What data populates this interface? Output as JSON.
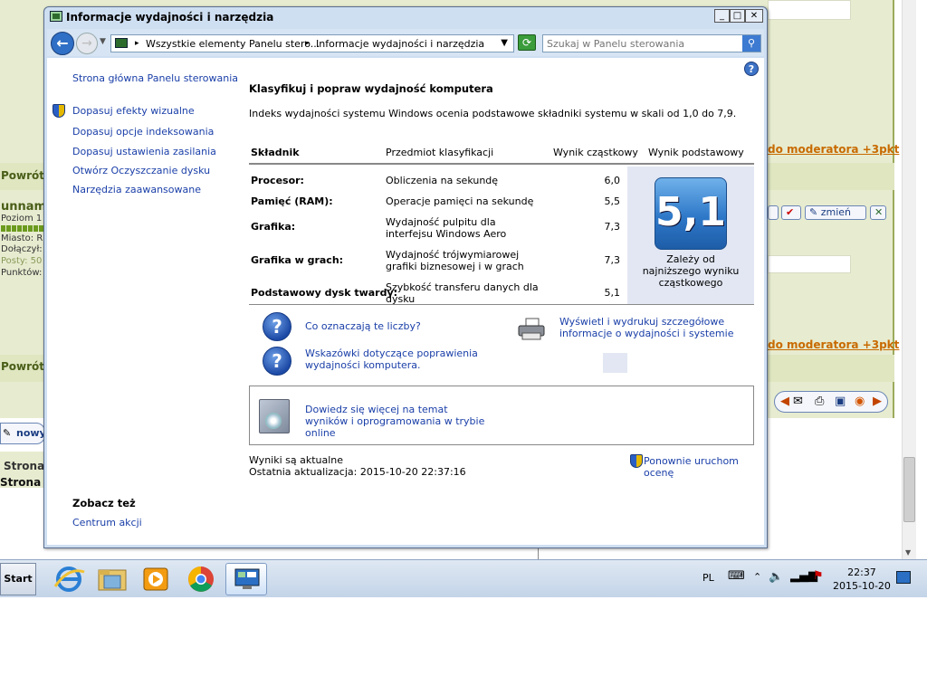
{
  "background_page": {
    "left_labels": [
      "Powrót",
      "unnam",
      "Poziom 1",
      "Miasto: R",
      "Dołączył:",
      "Posty: 50",
      "Punktów:",
      "Powrót",
      "nowy",
      "Strona",
      "Strona 1"
    ],
    "right_links": [
      "do moderatora +3pkt",
      "do moderatora +3pkt"
    ],
    "edit_button": "zmień"
  },
  "window": {
    "title": "Informacje wydajności i narzędzia",
    "controls": {
      "minimize": "_",
      "maximize": "□",
      "close": "✕"
    },
    "address": {
      "segment1": "Wszystkie elementy Panelu stero...",
      "segment2": "Informacje wydajności i narzędzia"
    },
    "search": {
      "placeholder": "Szukaj w Panelu sterowania"
    }
  },
  "sidebar": {
    "home": "Strona główna Panelu sterowania",
    "links": [
      "Dopasuj efekty wizualne",
      "Dopasuj opcje indeksowania",
      "Dopasuj ustawienia zasilania",
      "Otwórz Oczyszczanie dysku",
      "Narzędzia zaawansowane"
    ],
    "see_also_title": "Zobacz też",
    "see_also_link": "Centrum akcji"
  },
  "main": {
    "heading": "Klasyfikuj i popraw wydajność komputera",
    "description": "Indeks wydajności systemu Windows ocenia podstawowe składniki systemu w skali od 1,0 do 7,9.",
    "table": {
      "headers": [
        "Składnik",
        "Przedmiot klasyfikacji",
        "Wynik cząstkowy",
        "Wynik podstawowy"
      ],
      "rows": [
        {
          "component": "Procesor:",
          "subject": "Obliczenia na sekundę",
          "score": "6,0"
        },
        {
          "component": "Pamięć (RAM):",
          "subject": "Operacje pamięci na sekundę",
          "score": "5,5"
        },
        {
          "component": "Grafika:",
          "subject": "Wydajność pulpitu dla interfejsu Windows Aero",
          "score": "7,3"
        },
        {
          "component": "Grafika w grach:",
          "subject": "Wydajność trójwymiarowej grafiki biznesowej i w grach",
          "score": "7,3"
        },
        {
          "component": "Podstawowy dysk twardy:",
          "subject": "Szybkość transferu danych dla dysku",
          "score": "5,1"
        }
      ],
      "base_score": "5,1",
      "base_caption": "Zależy od najniższego wyniku cząstkowego"
    },
    "help_links": [
      "Co oznaczają te liczby?",
      "Wskazówki dotyczące poprawienia wydajności komputera."
    ],
    "print_link": "Wyświetl i wydrukuj szczegółowe informacje o wydajności i systemie",
    "online_link": "Dowiedz się więcej na temat wyników i oprogramowania w trybie online",
    "status_line1": "Wyniki są aktualne",
    "status_line2": "Ostatnia aktualizacja: 2015-10-20 22:37:16",
    "rerun": "Ponownie uruchom ocenę"
  },
  "taskbar": {
    "start": "Start",
    "language": "PL",
    "time": "22:37",
    "date": "2015-10-20"
  }
}
